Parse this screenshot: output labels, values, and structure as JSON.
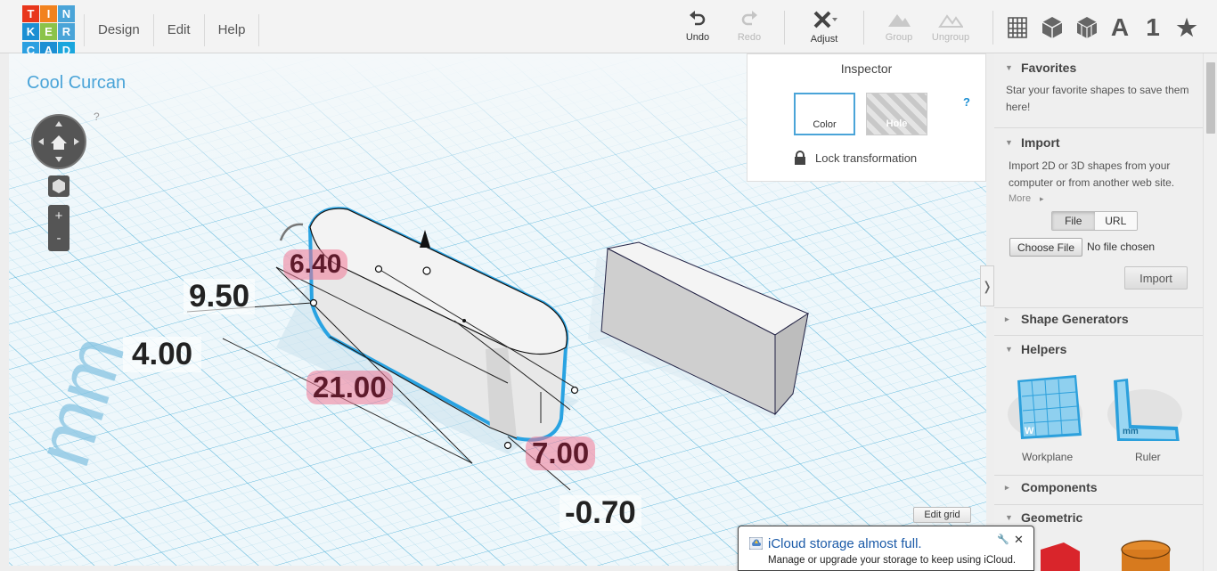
{
  "app": {
    "logo_letters": [
      "T",
      "I",
      "N",
      "K",
      "E",
      "R",
      "C",
      "A",
      "D"
    ],
    "menu": [
      "Design",
      "Edit",
      "Help"
    ]
  },
  "toolbar": {
    "undo": "Undo",
    "redo": "Redo",
    "adjust": "Adjust",
    "group": "Group",
    "ungroup": "Ungroup",
    "right_icons": [
      "workplane-grid-icon",
      "box-icon",
      "wireframe-icon",
      "text-icon",
      "number-icon",
      "star-icon"
    ],
    "text_glyph": "A",
    "number_glyph": "1",
    "star_glyph": "★"
  },
  "project": {
    "name": "Cool Curcan"
  },
  "view": {
    "help": "?"
  },
  "dimensions": {
    "top": "6.40",
    "width": "9.50",
    "depth": "4.00",
    "length": "21.00",
    "height": "7.00",
    "elevation": "-0.70",
    "unit_watermark": "mm"
  },
  "inspector": {
    "title": "Inspector",
    "color_label": "Color",
    "hole_label": "Hole",
    "help": "?",
    "lock_label": "Lock transformation"
  },
  "panel": {
    "favorites": {
      "title": "Favorites",
      "text": "Star your favorite shapes to save them here!"
    },
    "import": {
      "title": "Import",
      "text": "Import 2D or 3D shapes from your computer or from another web site.",
      "more": "More",
      "file_tab": "File",
      "url_tab": "URL",
      "choose": "Choose File",
      "no_file": "No file chosen",
      "button": "Import"
    },
    "shape_generators": "Shape Generators",
    "helpers": {
      "title": "Helpers",
      "workplane": "Workplane",
      "ruler": "Ruler",
      "workplane_mark": "W",
      "ruler_mark": "mm"
    },
    "components": "Components",
    "geometric": "Geometric"
  },
  "edit_grid": "Edit grid",
  "notification": {
    "title": "iCloud storage almost full.",
    "body": "Manage or upgrade your storage to keep using iCloud."
  }
}
